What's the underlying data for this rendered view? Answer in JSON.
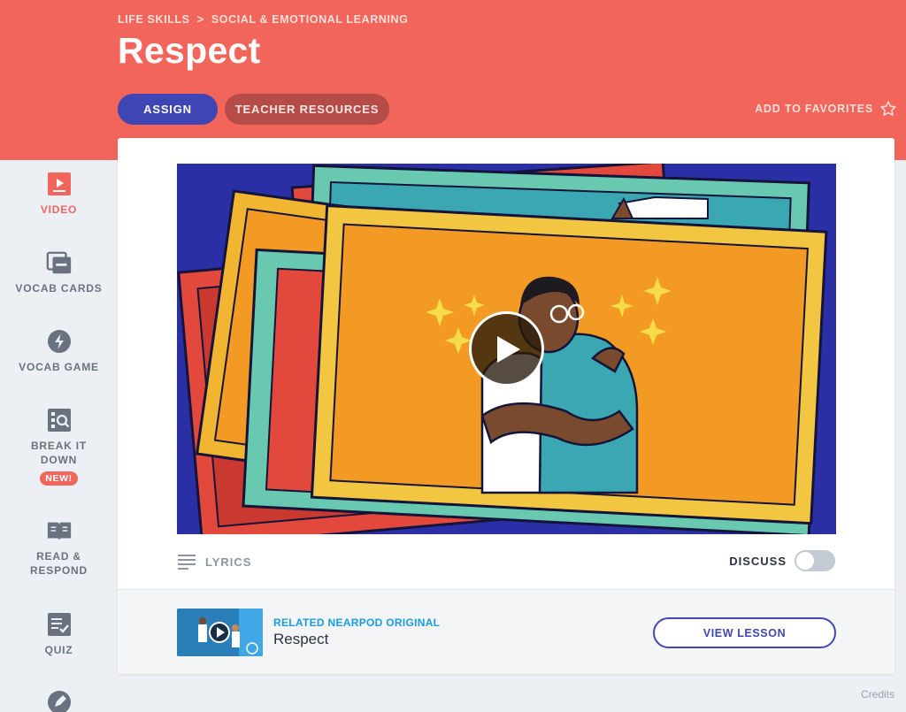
{
  "breadcrumb": {
    "items": [
      "LIFE SKILLS",
      "SOCIAL & EMOTIONAL LEARNING"
    ],
    "separator": ">"
  },
  "page": {
    "title": "Respect"
  },
  "actions": {
    "assign": "ASSIGN",
    "teacher_resources": "TEACHER RESOURCES",
    "favorites": "ADD TO FAVORITES"
  },
  "sidebar": {
    "items": [
      {
        "label": "VIDEO",
        "icon": "video-icon",
        "active": true
      },
      {
        "label": "VOCAB CARDS",
        "icon": "cards-icon"
      },
      {
        "label": "VOCAB GAME",
        "icon": "lightning-icon"
      },
      {
        "label": "BREAK IT DOWN",
        "icon": "magnify-icon",
        "badge": "NEW!"
      },
      {
        "label": "READ & RESPOND",
        "icon": "book-icon"
      },
      {
        "label": "QUIZ",
        "icon": "checklist-icon"
      }
    ]
  },
  "video_controls": {
    "lyrics": "LYRICS",
    "discuss": "DISCUSS",
    "discuss_on": false
  },
  "related": {
    "kicker": "RELATED NEARPOD ORIGINAL",
    "title": "Respect",
    "button": "VIEW LESSON"
  },
  "footer": {
    "credits": "Credits"
  },
  "colors": {
    "brand_coral": "#f2655b",
    "accent_indigo": "#3f46b4",
    "link_blue": "#1a9be0"
  }
}
